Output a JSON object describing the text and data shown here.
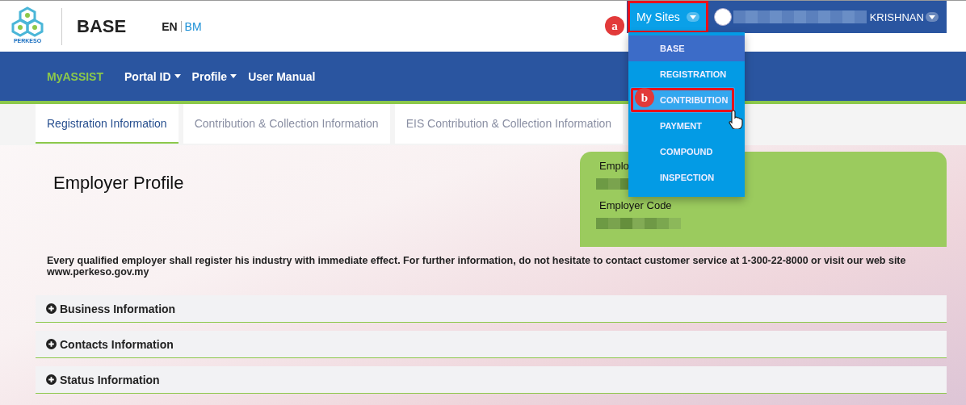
{
  "header": {
    "logo_text": "PERKESO",
    "app_title": "BASE",
    "languages": [
      {
        "label": "EN",
        "selected": true
      },
      {
        "label": "BM",
        "selected": false
      }
    ]
  },
  "user_bar": {
    "my_sites": {
      "label": "My Sites",
      "annotation": "a"
    },
    "user_name": "KRISHNAN"
  },
  "sites_menu": [
    {
      "label": "BASE",
      "selected": true,
      "hovered": false
    },
    {
      "label": "REGISTRATION",
      "selected": false,
      "hovered": false
    },
    {
      "label": "CONTRIBUTION",
      "selected": false,
      "hovered": true,
      "annotation": "b"
    },
    {
      "label": "PAYMENT",
      "selected": false,
      "hovered": false
    },
    {
      "label": "COMPOUND",
      "selected": false,
      "hovered": false
    },
    {
      "label": "INSPECTION",
      "selected": false,
      "hovered": false
    }
  ],
  "nav": [
    {
      "label": "MyASSIST",
      "dropdown": false,
      "selected": true
    },
    {
      "label": "Portal ID",
      "dropdown": true,
      "selected": false
    },
    {
      "label": "Profile",
      "dropdown": true,
      "selected": false
    },
    {
      "label": "User Manual",
      "dropdown": false,
      "selected": false
    }
  ],
  "tabs": [
    {
      "label": "Registration Information",
      "selected": true
    },
    {
      "label": "Contribution & Collection Information",
      "selected": false
    },
    {
      "label": "EIS Contribution & Collection Information",
      "selected": false
    }
  ],
  "profile": {
    "title": "Employer Profile",
    "card": [
      {
        "label": "Emplo"
      },
      {
        "label": "Employer Code"
      }
    ]
  },
  "notice": "Every qualified employer shall register his industry with immediate effect. For further information, do not hesitate to contact customer service at 1-300-22-8000 or visit our web site www.perkeso.gov.my",
  "sections": [
    {
      "title": "Business Information",
      "expanded": false
    },
    {
      "title": "Contacts Information",
      "expanded": false
    },
    {
      "title": "Status Information",
      "expanded": false
    }
  ]
}
